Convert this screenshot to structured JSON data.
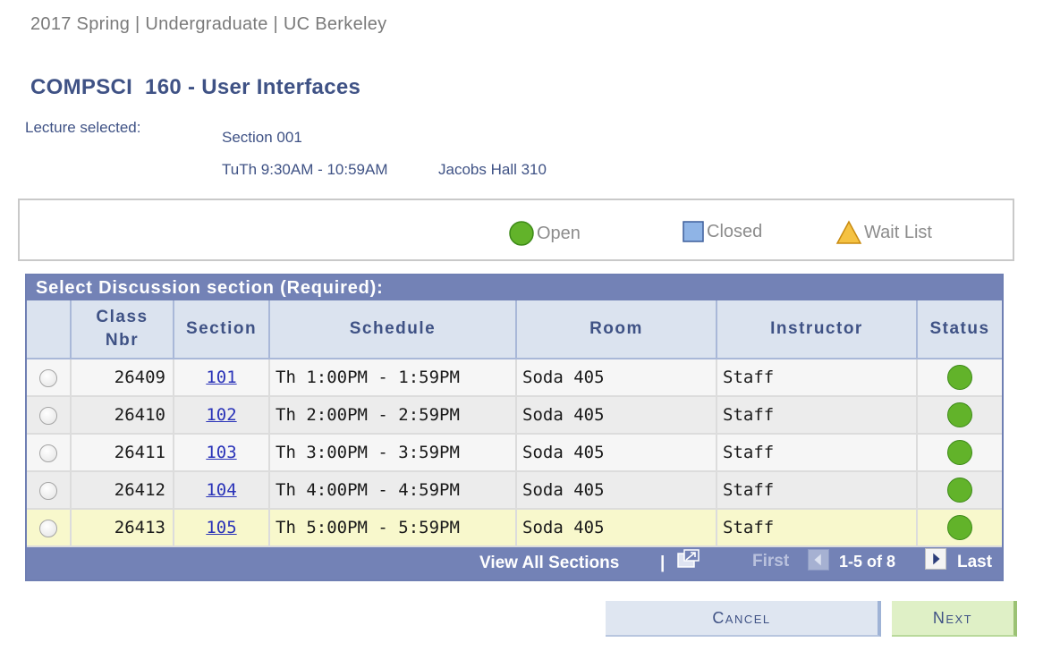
{
  "term_info": "2017 Spring | Undergraduate | UC Berkeley",
  "course": {
    "title": "COMPSCI  160 - User Interfaces"
  },
  "lecture": {
    "label": "Lecture selected:",
    "section": "Section 001",
    "time": "TuTh 9:30AM - 10:59AM",
    "room": "Jacobs Hall 310"
  },
  "legend": {
    "open": "Open",
    "closed": "Closed",
    "waitlist": "Wait List",
    "colors": {
      "open": "#62b32a",
      "closed": "#8fb4e6",
      "waitlist": "#f5c242"
    }
  },
  "grid": {
    "header": "Select Discussion section (Required):",
    "columns": {
      "class_nbr_line1": "Class",
      "class_nbr_line2": "Nbr",
      "section": "Section",
      "schedule": "Schedule",
      "room": "Room",
      "instructor": "Instructor",
      "status": "Status"
    },
    "rows": [
      {
        "class_nbr": "26409",
        "section": "101",
        "schedule": "Th 1:00PM - 1:59PM",
        "room": "Soda 405",
        "instructor": "Staff",
        "status": "Open"
      },
      {
        "class_nbr": "26410",
        "section": "102",
        "schedule": "Th 2:00PM - 2:59PM",
        "room": "Soda 405",
        "instructor": "Staff",
        "status": "Open"
      },
      {
        "class_nbr": "26411",
        "section": "103",
        "schedule": "Th 3:00PM - 3:59PM",
        "room": "Soda 405",
        "instructor": "Staff",
        "status": "Open"
      },
      {
        "class_nbr": "26412",
        "section": "104",
        "schedule": "Th 4:00PM - 4:59PM",
        "room": "Soda 405",
        "instructor": "Staff",
        "status": "Open"
      },
      {
        "class_nbr": "26413",
        "section": "105",
        "schedule": "Th 5:00PM - 5:59PM",
        "room": "Soda 405",
        "instructor": "Staff",
        "status": "Open"
      }
    ],
    "footer": {
      "view_all": "View All Sections",
      "separator": "|",
      "first": "First",
      "range": "1-5 of 8",
      "last": "Last"
    }
  },
  "buttons": {
    "cancel": "Cancel",
    "next": "Next"
  }
}
